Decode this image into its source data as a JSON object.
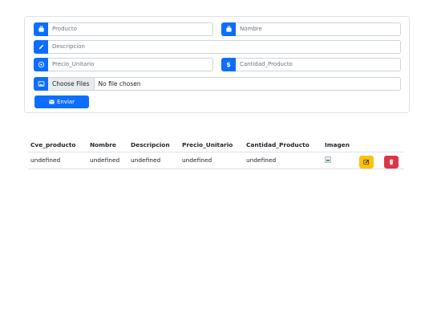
{
  "form": {
    "producto_placeholder": "Producto",
    "nombre_placeholder": "Nombre",
    "descripcion_placeholder": "Descripcion",
    "precio_placeholder": "Precio_Unitario",
    "cantidad_placeholder": "Cantidad_Producto",
    "precio_prefix": "$",
    "file_button": "Choose Files",
    "file_status": "No file chosen",
    "submit_label": "Enviar"
  },
  "table": {
    "columns": [
      "Cve_producto",
      "Nombre",
      "Descripcion",
      "Precio_Unitario",
      "Cantidad_Producto",
      "Imagen"
    ],
    "rows": [
      {
        "cve": "undefined",
        "nombre": "undefined",
        "descripcion": "undefined",
        "precio": "undefined",
        "cantidad": "undefined"
      }
    ]
  },
  "colors": {
    "primary": "#0d6efd",
    "edit": "#ffc107",
    "delete": "#dc3545"
  },
  "icons": [
    "box-icon",
    "tag-icon",
    "pencil-icon",
    "currency-circle-icon",
    "dollar-icon",
    "image-icon",
    "envelope-icon",
    "edit-icon",
    "trash-icon"
  ]
}
